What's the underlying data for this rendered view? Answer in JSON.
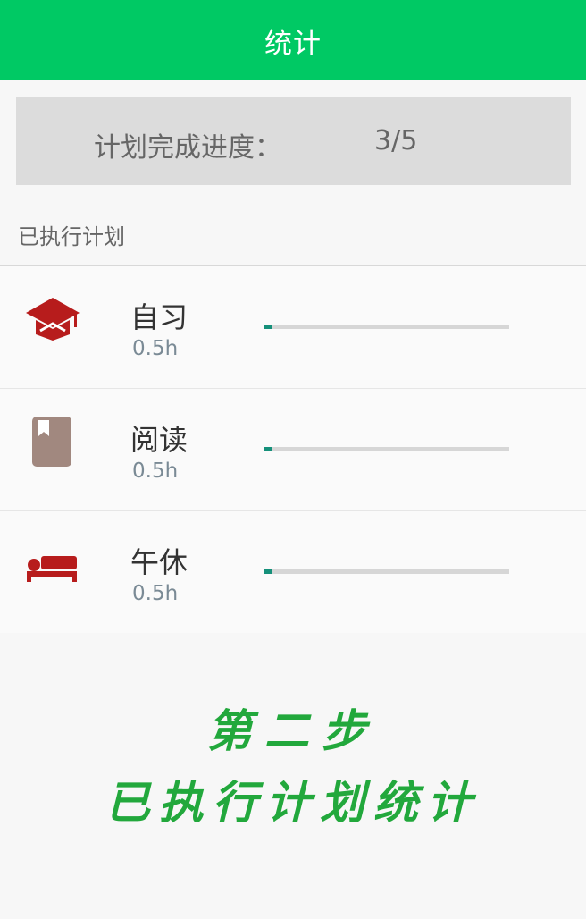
{
  "appbar": {
    "title": "统计"
  },
  "progress": {
    "label": "计划完成进度：",
    "value": "3/5"
  },
  "section": {
    "header": "已执行计划"
  },
  "plans": [
    {
      "name": "自习",
      "duration": "0.5h",
      "icon": "graduation-cap-icon",
      "icon_color": "#b71c1c",
      "progress": 0.03
    },
    {
      "name": "阅读",
      "duration": "0.5h",
      "icon": "bookmark-book-icon",
      "icon_color": "#a1887f",
      "progress": 0.03
    },
    {
      "name": "午休",
      "duration": "0.5h",
      "icon": "bed-icon",
      "icon_color": "#b71c1c",
      "progress": 0.03
    }
  ],
  "caption": {
    "line1": "第二步",
    "line2": "已执行计划统计"
  },
  "colors": {
    "accent": "#00c964",
    "bar_fill": "#15907a",
    "caption": "#22a83c"
  }
}
